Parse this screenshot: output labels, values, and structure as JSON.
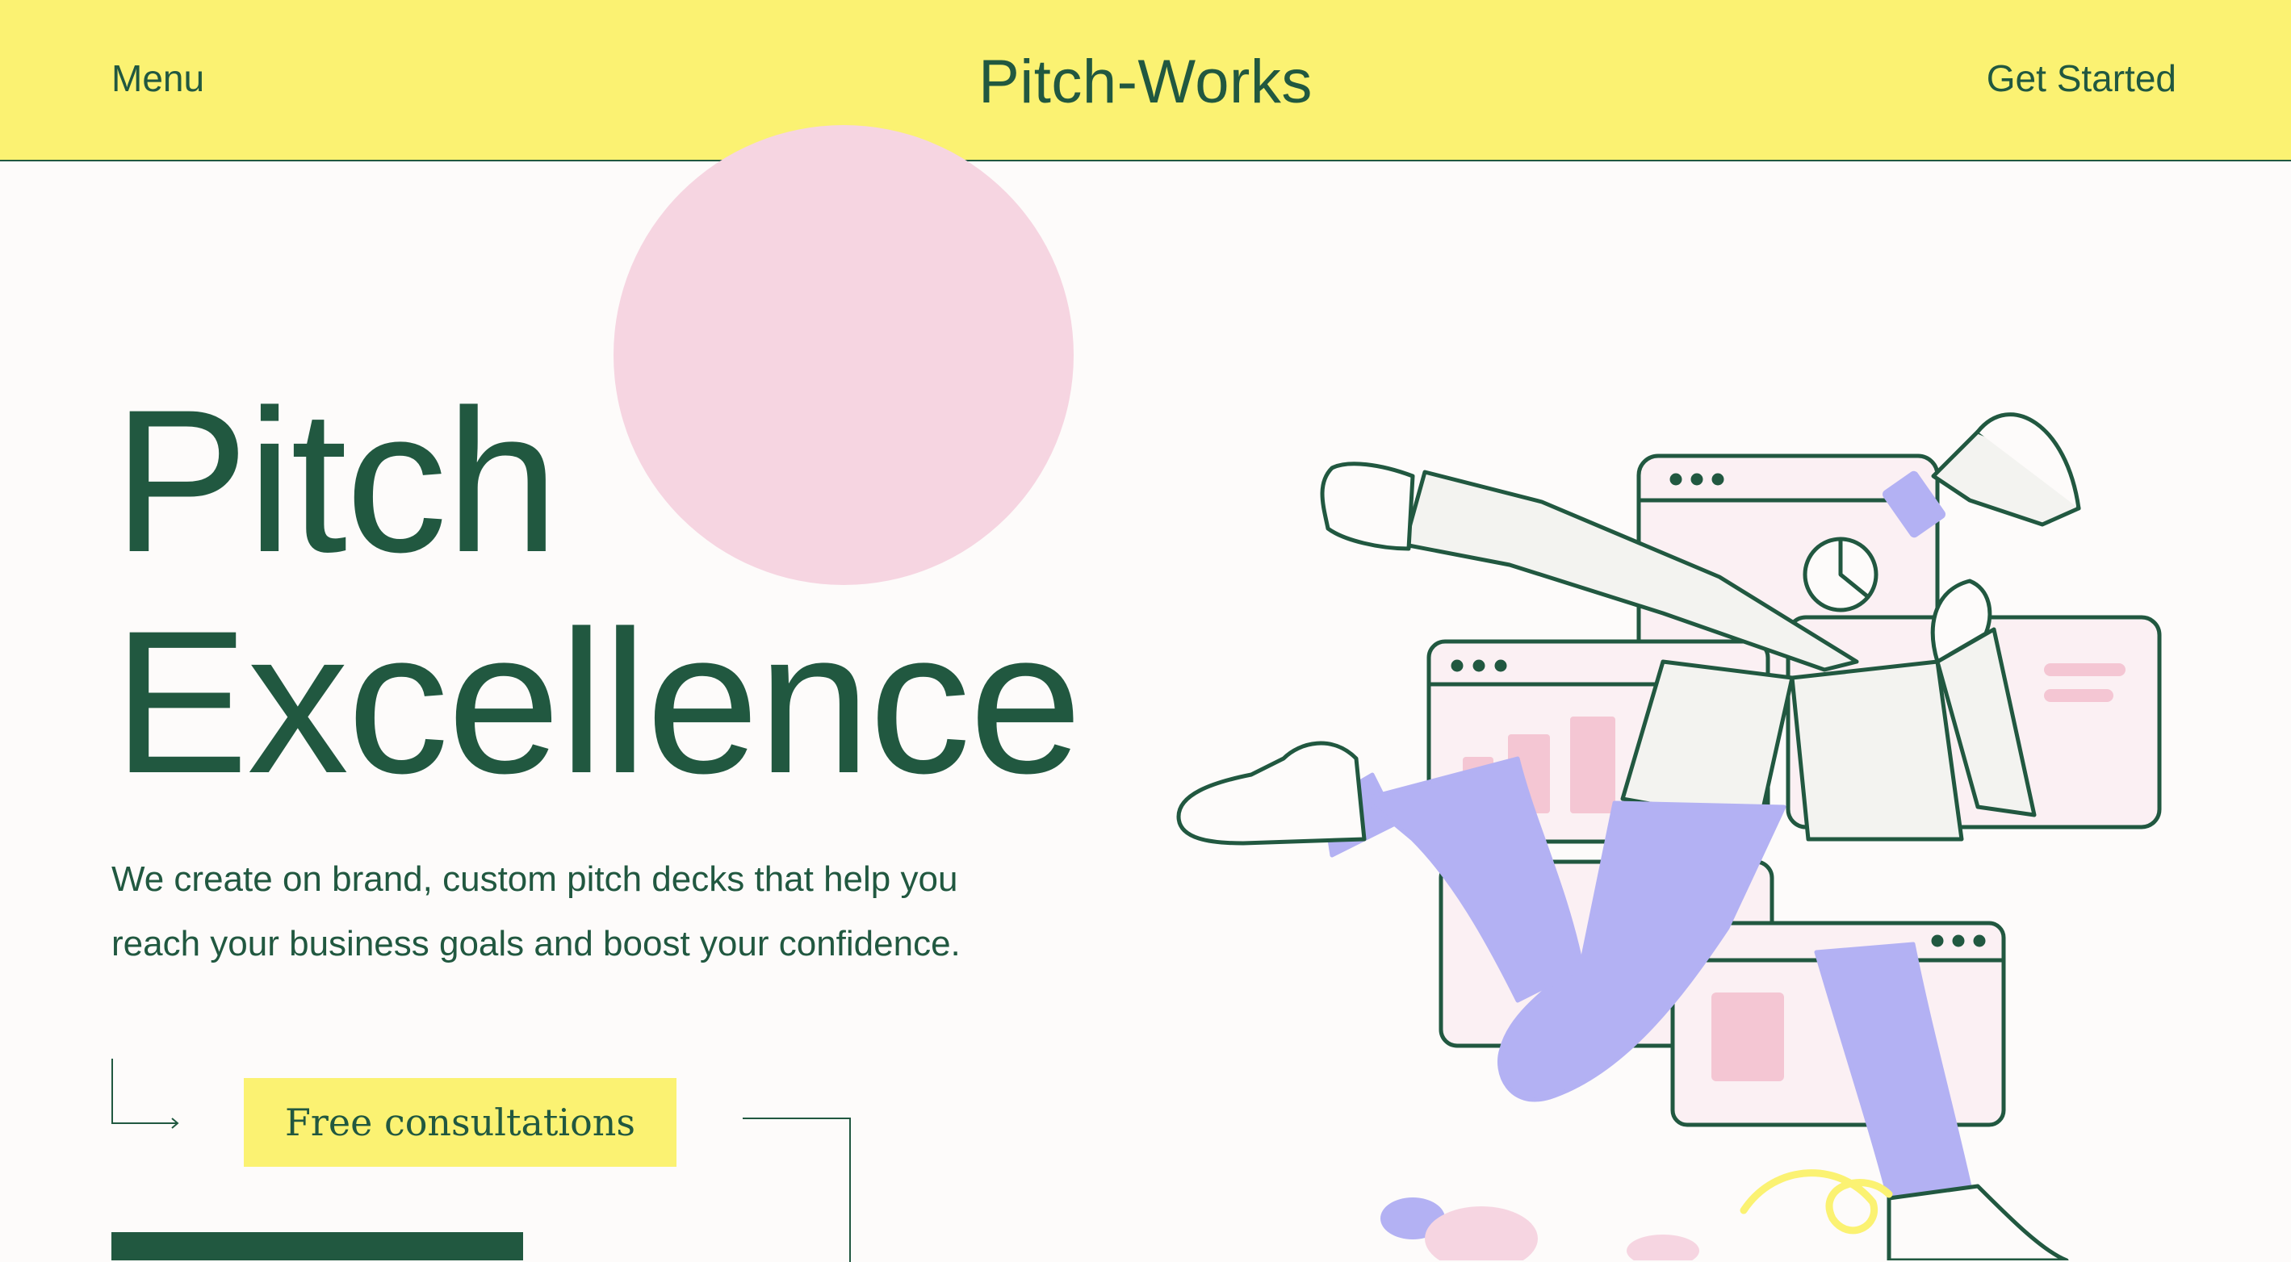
{
  "header": {
    "menu_label": "Menu",
    "brand": "Pitch-Works",
    "cta_label": "Get Started"
  },
  "hero": {
    "title_line1": "Pitch",
    "title_line2": "Excellence",
    "description": "We create on brand, custom pitch decks that help you reach your business goals and boost your confidence.",
    "consult_button": "Free consultations"
  },
  "icons": {
    "arrow": "corner-arrow-icon",
    "illustration": "figure-with-megaphone-illustration"
  },
  "colors": {
    "header_bg": "#fbf272",
    "text_green": "#215840",
    "accent_pink": "#f6d5e1",
    "accent_purple": "#b3b1f3",
    "page_bg": "#fdfbfa"
  }
}
